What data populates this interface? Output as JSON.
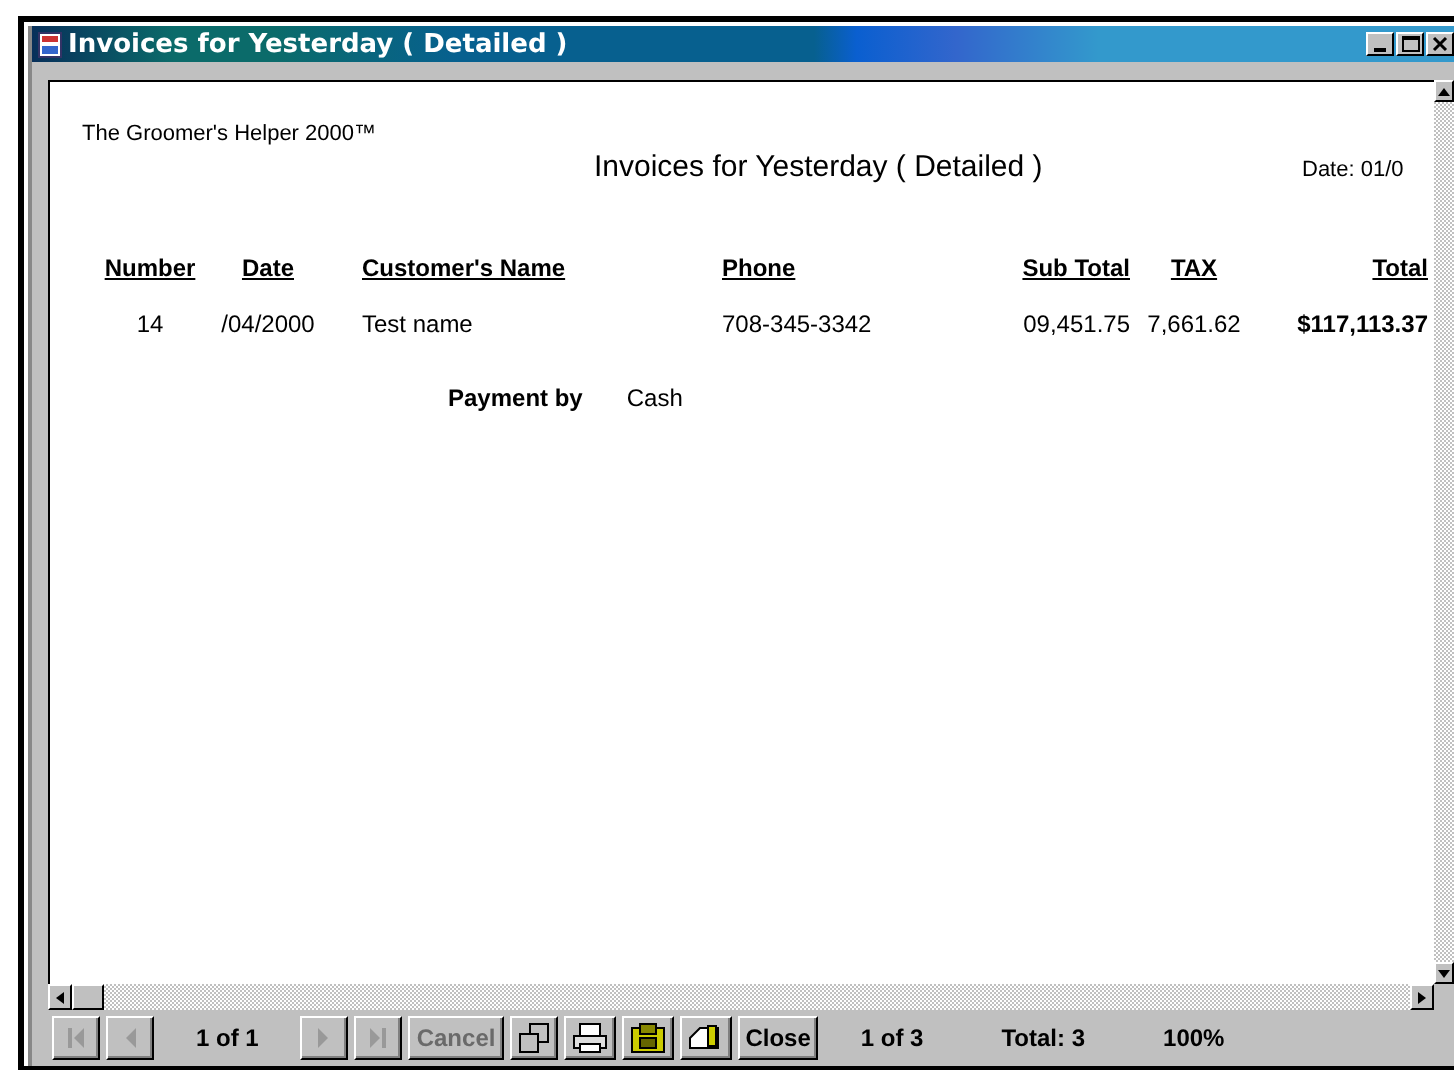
{
  "window": {
    "title": "Invoices for Yesterday ( Detailed )"
  },
  "report": {
    "company": "The Groomer's Helper 2000™",
    "title": "Invoices for Yesterday ( Detailed )",
    "date": "Date:  01/0",
    "columns": [
      "Number",
      "Date",
      "Customer's Name",
      "Phone",
      "Sub Total",
      "TAX",
      "Total"
    ],
    "rows": [
      {
        "cells": [
          "14",
          "/04/2000",
          "Test name",
          "708-345-3342",
          "09,451.75",
          "7,661.62",
          "$117,113.37"
        ],
        "payment_label": "Payment by",
        "payment": "Cash"
      }
    ]
  },
  "toolbar": [
    {
      "kind": "first",
      "disabled": true
    },
    {
      "kind": "prev",
      "disabled": true
    },
    {
      "kind": "text",
      "label": "1 of 1"
    },
    {
      "kind": "next",
      "disabled": true
    },
    {
      "kind": "last",
      "disabled": true
    },
    {
      "kind": "button",
      "label": "Cancel",
      "disabled": true
    },
    {
      "kind": "zoom",
      "disabled": false
    },
    {
      "kind": "print",
      "disabled": false
    },
    {
      "kind": "export",
      "disabled": false
    },
    {
      "kind": "mail",
      "disabled": false
    },
    {
      "kind": "button",
      "label": "Close",
      "disabled": false
    },
    {
      "kind": "text",
      "label": "1 of 3"
    },
    {
      "kind": "text",
      "label": "Total: 3"
    },
    {
      "kind": "text",
      "label": "100%"
    }
  ]
}
